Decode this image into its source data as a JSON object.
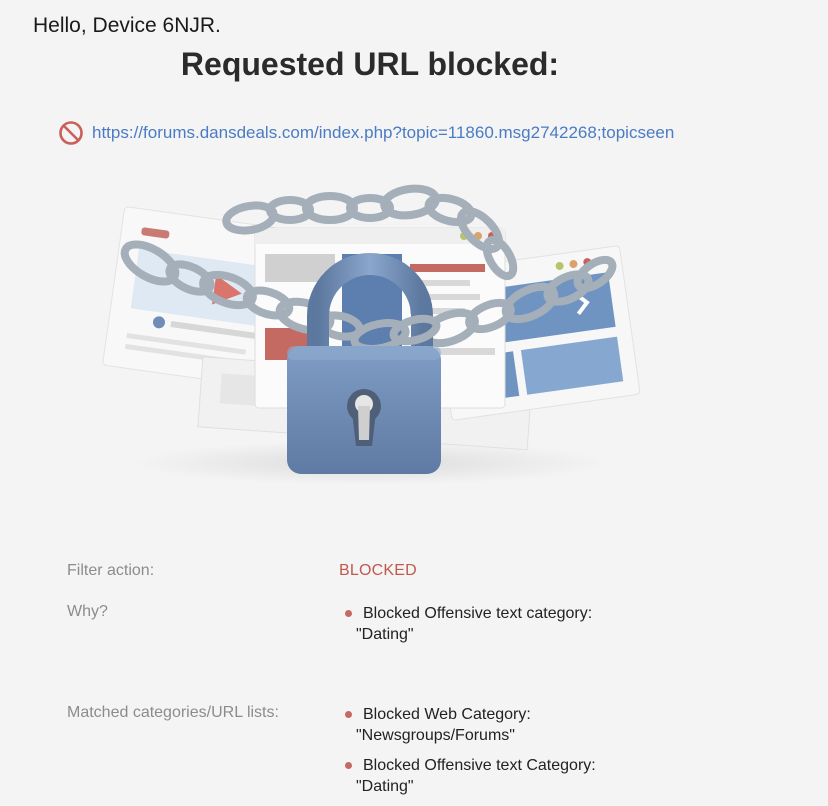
{
  "greeting": "Hello, Device 6NJR.",
  "title": "Requested URL blocked:",
  "blocked_url": "https://forums.dansdeals.com/index.php?topic=11860.msg2742268;topicseen",
  "details": {
    "filter_action": {
      "label": "Filter action:",
      "value": "BLOCKED"
    },
    "why": {
      "label": "Why?",
      "items": [
        {
          "line1": "Blocked Offensive text category:",
          "line2": "\"Dating\""
        }
      ]
    },
    "matched": {
      "label": "Matched categories/URL lists:",
      "items": [
        {
          "line1": "Blocked Web Category:",
          "line2": "\"Newsgroups/Forums\""
        },
        {
          "line1": "Blocked Offensive text Category:",
          "line2": "\"Dating\""
        }
      ]
    }
  },
  "colors": {
    "background": "#f4f4f4",
    "link": "#4a7bc4",
    "blocked": "#c0594f",
    "bullet": "#c46a62",
    "muted_label": "#8c8c8c",
    "lock_blue": "#6f8db8"
  },
  "icons": {
    "url_prefix": "no-entry-icon",
    "illustration": "padlock-chained-browser-windows-illustration"
  }
}
